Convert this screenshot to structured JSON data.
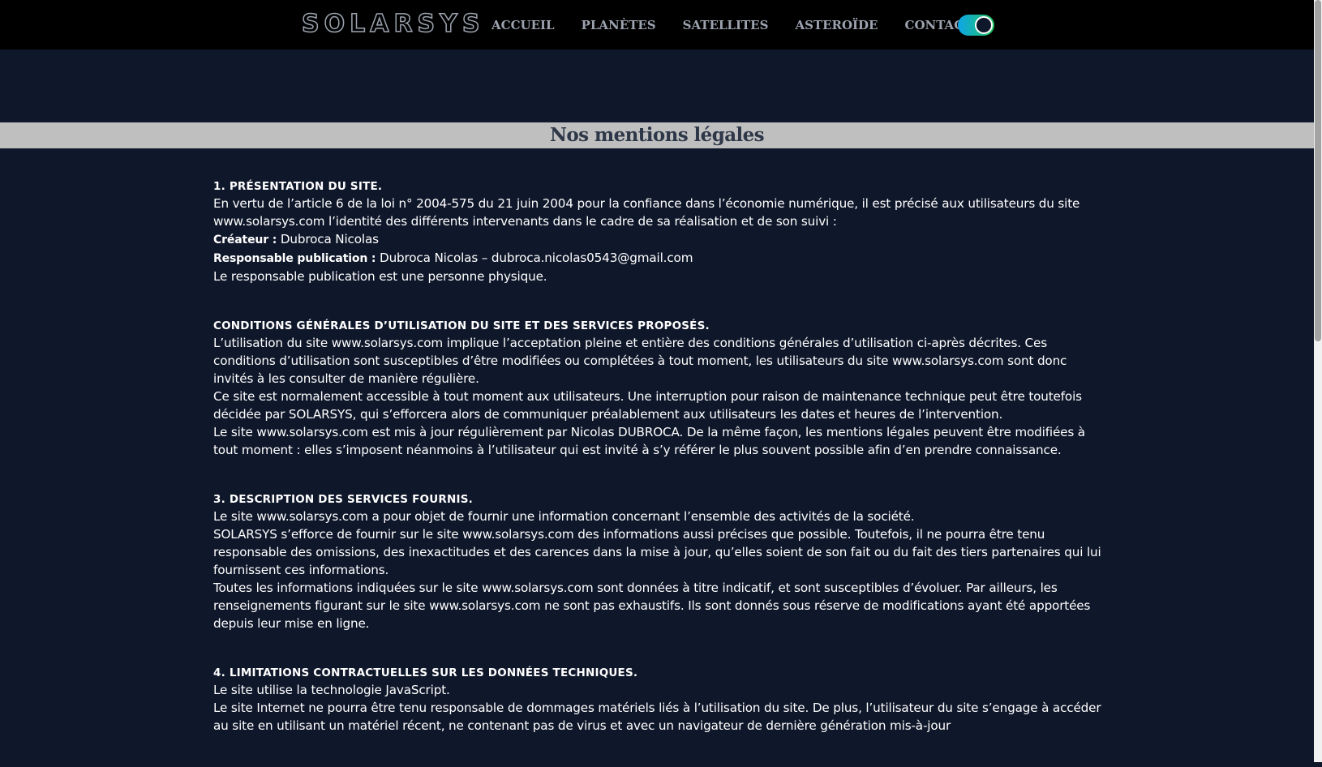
{
  "header": {
    "logo": "SOLARSYS",
    "nav": [
      "ACCUEIL",
      "PLANÈTES",
      "SATELLITES",
      "ASTEROÏDE",
      "CONTACT"
    ],
    "theme_toggle_state": "on"
  },
  "page_title": "Nos mentions légales",
  "sections": [
    {
      "heading": "1. PRÉSENTATION DU SITE.",
      "paragraphs": [
        "En vertu de l’article 6 de la loi n° 2004-575 du 21 juin 2004 pour la confiance dans l’économie numérique, il est précisé aux utilisateurs du site www.solarsys.com l’identité des différents intervenants dans le cadre de sa réalisation et de son suivi :"
      ],
      "creator_label": "Créateur :",
      "creator_value": " Dubroca Nicolas",
      "publisher_label": "Responsable publication :",
      "publisher_value": " Dubroca Nicolas – dubroca.nicolas0543@gmail.com",
      "closing": "Le responsable publication est une personne physique."
    },
    {
      "heading": "CONDITIONS GÉNÉRALES D’UTILISATION DU SITE ET DES SERVICES PROPOSÉS.",
      "paragraphs": [
        "L’utilisation du site www.solarsys.com implique l’acceptation pleine et entière des conditions générales d’utilisation ci-après décrites. Ces conditions d’utilisation sont susceptibles d’être modifiées ou complétées à tout moment, les utilisateurs du site www.solarsys.com sont donc invités à les consulter de manière régulière.",
        "Ce site est normalement accessible à tout moment aux utilisateurs. Une interruption pour raison de maintenance technique peut être toutefois décidée par SOLARSYS, qui s’efforcera alors de communiquer préalablement aux utilisateurs les dates et heures de l’intervention.",
        "Le site www.solarsys.com est mis à jour régulièrement par Nicolas DUBROCA. De la même façon, les mentions légales peuvent être modifiées à tout moment : elles s’imposent néanmoins à l’utilisateur qui est invité à s’y référer le plus souvent possible afin d’en prendre connaissance."
      ]
    },
    {
      "heading": "3. DESCRIPTION DES SERVICES FOURNIS.",
      "paragraphs": [
        "Le site www.solarsys.com a pour objet de fournir une information concernant l’ensemble des activités de la société.",
        "SOLARSYS s’efforce de fournir sur le site www.solarsys.com des informations aussi précises que possible. Toutefois, il ne pourra être tenu responsable des omissions, des inexactitudes et des carences dans la mise à jour, qu’elles soient de son fait ou du fait des tiers partenaires qui lui fournissent ces informations.",
        "Toutes les informations indiquées sur le site www.solarsys.com sont données à titre indicatif, et sont susceptibles d’évoluer. Par ailleurs, les renseignements figurant sur le site www.solarsys.com ne sont pas exhaustifs. Ils sont donnés sous réserve de modifications ayant été apportées depuis leur mise en ligne."
      ]
    },
    {
      "heading": "4. LIMITATIONS CONTRACTUELLES SUR LES DONNÉES TECHNIQUES.",
      "paragraphs": [
        "Le site utilise la technologie JavaScript.",
        "Le site Internet ne pourra être tenu responsable de dommages matériels liés à l’utilisation du site. De plus, l’utilisateur du site s’engage à accéder au site en utilisant un matériel récent, ne contenant pas de virus et avec un navigateur de dernière génération mis-à-jour"
      ]
    }
  ]
}
